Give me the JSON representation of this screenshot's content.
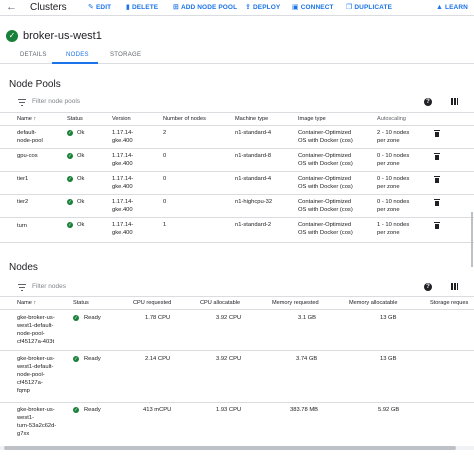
{
  "topbar": {
    "title": "Clusters",
    "actions": [
      {
        "label": "EDIT",
        "icon": "pencil-icon",
        "glyph": "✎"
      },
      {
        "label": "DELETE",
        "icon": "trash-icon",
        "glyph": "🗑"
      },
      {
        "label": "ADD NODE POOL",
        "icon": "add-box-icon",
        "glyph": "⊞"
      },
      {
        "label": "DEPLOY",
        "icon": "upload-icon",
        "glyph": "⇪"
      },
      {
        "label": "CONNECT",
        "icon": "terminal-icon",
        "glyph": "▣"
      },
      {
        "label": "DUPLICATE",
        "icon": "copy-icon",
        "glyph": "❐"
      },
      {
        "label": "LEARN",
        "icon": "school-icon",
        "glyph": "🎓"
      }
    ]
  },
  "cluster": {
    "name": "broker-us-west1",
    "status": "ok"
  },
  "tabs": [
    {
      "label": "DETAILS",
      "active": false
    },
    {
      "label": "NODES",
      "active": true
    },
    {
      "label": "STORAGE",
      "active": false
    }
  ],
  "node_pools": {
    "heading": "Node Pools",
    "filter_placeholder": "Filter node pools",
    "columns": [
      "Name",
      "Status",
      "Version",
      "Number of nodes",
      "Machine type",
      "Image type",
      "Autoscaling"
    ],
    "sort_arrow": "↑",
    "rows": [
      {
        "name": "default-\nnode-pool",
        "status": "Ok",
        "version": "1.17.14-\ngke.400",
        "nodes": "2",
        "machine": "n1-standard-4",
        "image": "Container-Optimized\nOS with Docker (cos)",
        "autoscaling": "2 - 10 nodes\nper zone"
      },
      {
        "name": "gpu-cos",
        "status": "Ok",
        "version": "1.17.14-\ngke.400",
        "nodes": "0",
        "machine": "n1-standard-8",
        "image": "Container-Optimized\nOS with Docker (cos)",
        "autoscaling": "0 - 10 nodes\nper zone"
      },
      {
        "name": "tier1",
        "status": "Ok",
        "version": "1.17.14-\ngke.400",
        "nodes": "0",
        "machine": "n1-standard-4",
        "image": "Container-Optimized\nOS with Docker (cos)",
        "autoscaling": "0 - 10 nodes\nper zone"
      },
      {
        "name": "tier2",
        "status": "Ok",
        "version": "1.17.14-\ngke.400",
        "nodes": "0",
        "machine": "n1-highcpu-32",
        "image": "Container-Optimized\nOS with Docker (cos)",
        "autoscaling": "0 - 10 nodes\nper zone"
      },
      {
        "name": "turn",
        "status": "Ok",
        "version": "1.17.14-\ngke.400",
        "nodes": "1",
        "machine": "n1-standard-2",
        "image": "Container-Optimized\nOS with Docker (cos)",
        "autoscaling": "1 - 10 nodes\nper zone"
      }
    ]
  },
  "nodes": {
    "heading": "Nodes",
    "filter_placeholder": "Filter nodes",
    "columns": [
      "Name",
      "Status",
      "CPU requested",
      "CPU allocatable",
      "Memory requested",
      "Memory allocatable",
      "Storage reques"
    ],
    "sort_arrow": "↑",
    "rows": [
      {
        "name": "gke-broker-us-\nwest1-default-\nnode-pool-\ncf45127a-403t",
        "status": "Ready",
        "cpu_req": "1.78 CPU",
        "cpu_alloc": "3.92 CPU",
        "mem_req": "3.1 GB",
        "mem_alloc": "13 GB"
      },
      {
        "name": "gke-broker-us-\nwest1-default-\nnode-pool-\ncf45127a-\nfqmp",
        "status": "Ready",
        "cpu_req": "2.14 CPU",
        "cpu_alloc": "3.92 CPU",
        "mem_req": "3.74 GB",
        "mem_alloc": "13 GB"
      },
      {
        "name": "gke-broker-us-\nwest1-\nturn-53a2c62d-\ng7xx",
        "status": "Ready",
        "cpu_req": "413 mCPU",
        "cpu_alloc": "1.93 CPU",
        "mem_req": "383.78 MB",
        "mem_alloc": "5.92 GB"
      }
    ]
  },
  "colors": {
    "accent": "#1a73e8",
    "ok": "#188038",
    "divider": "#dadce0"
  }
}
